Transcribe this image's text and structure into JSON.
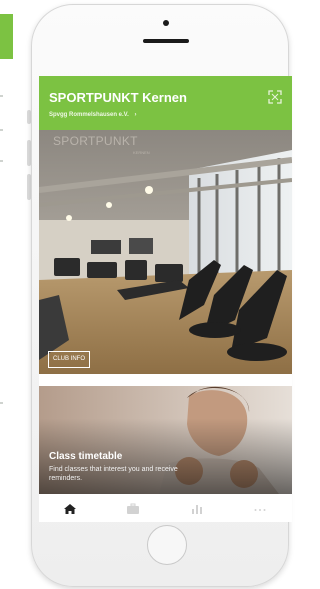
{
  "app": {
    "title": "SPORTPUNKT Kernen",
    "subtitle": "Spvgg Rommelshausen e.V.",
    "subtitle_chevron": "›"
  },
  "hero": {
    "logo": "SPORTPUNKT",
    "logo_sub": "KERNEN",
    "club_info_label": "CLUB INFO"
  },
  "card": {
    "title": "Class timetable",
    "description": "Find classes that interest you and receive reminders."
  },
  "tabs": [
    {
      "icon": "home-icon",
      "active": true
    },
    {
      "icon": "briefcase-icon",
      "active": false
    },
    {
      "icon": "bar-chart-icon",
      "active": false
    },
    {
      "icon": "more-icon",
      "active": false
    }
  ],
  "colors": {
    "brand_green": "#7cc242",
    "tab_active": "#222222",
    "tab_inactive": "#d2d2d2"
  }
}
